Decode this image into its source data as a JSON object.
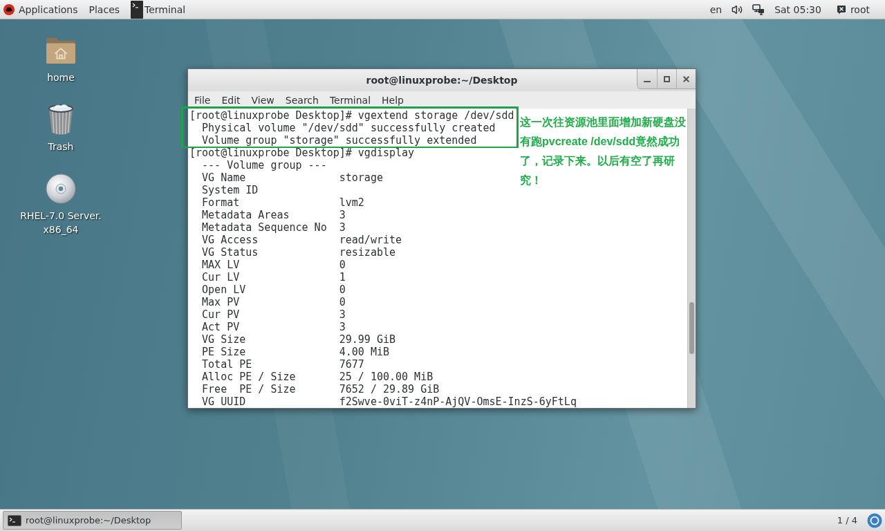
{
  "top_bar": {
    "menus": [
      {
        "kind": "applications",
        "label": "Applications"
      },
      {
        "kind": "places",
        "label": "Places"
      }
    ],
    "app_menu": {
      "label": "Terminal"
    },
    "keyboard_layout": "en",
    "clock": "Sat 05:30",
    "user": "root"
  },
  "desktop_icons": [
    {
      "kind": "folder",
      "label_lines": [
        "home"
      ]
    },
    {
      "kind": "trash",
      "label_lines": [
        "Trash"
      ]
    },
    {
      "kind": "disc",
      "label_lines": [
        "RHEL-7.0 Server.",
        "x86_64"
      ]
    }
  ],
  "terminal_window": {
    "title": "root@linuxprobe:~/Desktop",
    "menu": [
      "File",
      "Edit",
      "View",
      "Search",
      "Terminal",
      "Help"
    ],
    "lines": [
      {
        "text": "[root@linuxprobe Desktop]# vgextend storage /dev/sdd",
        "highlighted": true
      },
      {
        "text": "  Physical volume \"/dev/sdd\" successfully created",
        "highlighted": true
      },
      {
        "text": "  Volume group \"storage\" successfully extended",
        "highlighted": true
      },
      {
        "text": "[root@linuxprobe Desktop]# vgdisplay",
        "highlighted": false
      },
      {
        "text": "  --- Volume group ---",
        "highlighted": false
      },
      {
        "text": "  VG Name               storage",
        "highlighted": false
      },
      {
        "text": "  System ID",
        "highlighted": false
      },
      {
        "text": "  Format                lvm2",
        "highlighted": false
      },
      {
        "text": "  Metadata Areas        3",
        "highlighted": false
      },
      {
        "text": "  Metadata Sequence No  3",
        "highlighted": false
      },
      {
        "text": "  VG Access             read/write",
        "highlighted": false
      },
      {
        "text": "  VG Status             resizable",
        "highlighted": false
      },
      {
        "text": "  MAX LV                0",
        "highlighted": false
      },
      {
        "text": "  Cur LV                1",
        "highlighted": false
      },
      {
        "text": "  Open LV               0",
        "highlighted": false
      },
      {
        "text": "  Max PV                0",
        "highlighted": false
      },
      {
        "text": "  Cur PV                3",
        "highlighted": false
      },
      {
        "text": "  Act PV                3",
        "highlighted": false
      },
      {
        "text": "  VG Size               29.99 GiB",
        "highlighted": false
      },
      {
        "text": "  PE Size               4.00 MiB",
        "highlighted": false
      },
      {
        "text": "  Total PE              7677",
        "highlighted": false
      },
      {
        "text": "  Alloc PE / Size       25 / 100.00 MiB",
        "highlighted": false
      },
      {
        "text": "  Free  PE / Size       7652 / 29.89 GiB",
        "highlighted": false
      },
      {
        "text": "  VG UUID               f2Swve-0viT-z4nP-AjQV-OmsE-InzS-6yFtLq",
        "highlighted": false
      }
    ],
    "note": "这一次往资源池里面增加新硬盘没有跑pvcreate /dev/sdd竟然成功了，记录下来。以后有空了再研究！"
  },
  "bottom_bar": {
    "tasks": [
      {
        "label": "root@linuxprobe:~/Desktop",
        "selected": true
      }
    ],
    "workspace": "1 / 4"
  }
}
